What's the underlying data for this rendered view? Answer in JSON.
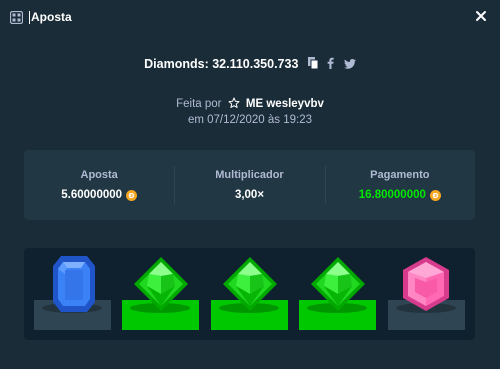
{
  "header": {
    "title": "Aposta"
  },
  "bet_info": {
    "diamonds_label": "Diamonds: 32.110.350.733",
    "made_by_prefix": "Feita por",
    "user": "ME wesleyvbv",
    "date": "em 07/12/2020 às 19:23"
  },
  "stats": [
    {
      "label": "Aposta",
      "value": "5.60000000",
      "coin": true,
      "color": "#ffffff"
    },
    {
      "label": "Multiplicador",
      "value": "3,00×",
      "coin": false,
      "color": "#ffffff"
    },
    {
      "label": "Pagamento",
      "value": "16.80000000",
      "coin": true,
      "color": "#00e701"
    }
  ],
  "gems": [
    {
      "kind": "sapphire-gem",
      "color": "#2f6fe4",
      "tile": "default"
    },
    {
      "kind": "emerald-gem",
      "color": "#00e701",
      "tile": "green"
    },
    {
      "kind": "emerald-gem",
      "color": "#00e701",
      "tile": "green"
    },
    {
      "kind": "emerald-gem",
      "color": "#00e701",
      "tile": "green"
    },
    {
      "kind": "pink-gem",
      "color": "#f35ca8",
      "tile": "default"
    }
  ],
  "colors": {
    "background": "#1a2c38",
    "panel": "#213743",
    "board": "#0f212e",
    "win": "#00e701"
  }
}
